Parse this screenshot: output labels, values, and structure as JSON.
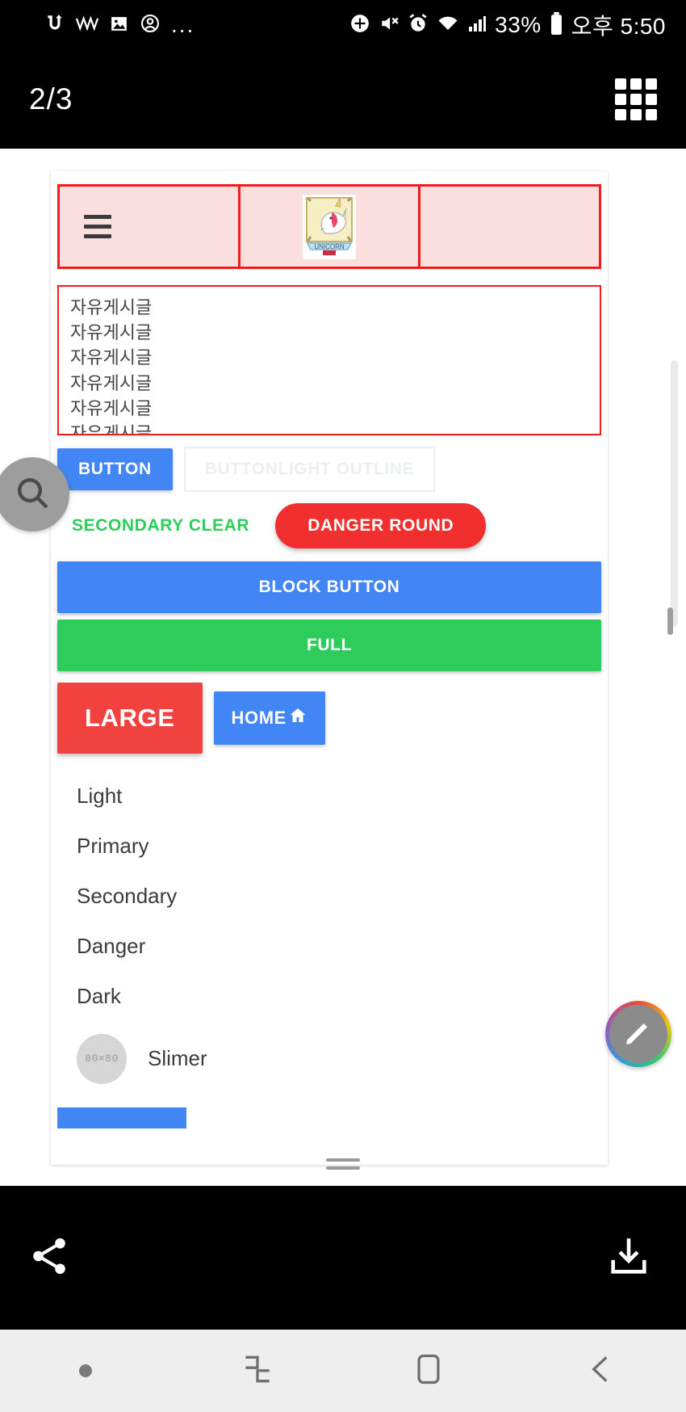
{
  "status_bar": {
    "left_icons": [
      "app-badge-icon",
      "signal-wave-icon",
      "image-icon",
      "account-icon"
    ],
    "overflow": "...",
    "right_icons": [
      "location-icon",
      "mute-icon",
      "alarm-icon",
      "wifi-icon",
      "cellular-icon"
    ],
    "battery_percent": "33%",
    "clock": "오후 5:50"
  },
  "title_bar": {
    "page_indicator": "2/3",
    "grid_button": "grid-view-button"
  },
  "page": {
    "header": {
      "menu_icon": "hamburger-menu-icon",
      "logo_label": "UNICORN",
      "cells": 3
    },
    "textarea": {
      "lines": [
        "자유게시글",
        "자유게시글",
        "자유게시글",
        "자유게시글",
        "자유게시글",
        "자유게시글"
      ]
    },
    "buttons": {
      "primary": "BUTTON",
      "light_outline": "BUTTONLIGHT OUTLINE",
      "secondary_clear": "SECONDARY CLEAR",
      "danger_round": "DANGER ROUND",
      "block": "BLOCK BUTTON",
      "full": "FULL",
      "large": "LARGE",
      "home": "HOME"
    },
    "list": {
      "items": [
        {
          "label": "Light"
        },
        {
          "label": "Primary"
        },
        {
          "label": "Secondary"
        },
        {
          "label": "Danger"
        },
        {
          "label": "Dark"
        }
      ],
      "avatar_item": {
        "label": "Slimer",
        "avatar_text": "80×80"
      }
    }
  },
  "colors": {
    "primary": "#4285f4",
    "success": "#2ecc5b",
    "danger": "#f22f2f",
    "large_red": "#f2423f",
    "header_border": "#f21c1c",
    "header_bg": "#fbdede"
  },
  "action_bar": {
    "share": "share-button",
    "save": "download-button"
  },
  "nav_bar": {
    "items": [
      "dot-indicator",
      "recents-button",
      "home-button",
      "back-button"
    ]
  }
}
